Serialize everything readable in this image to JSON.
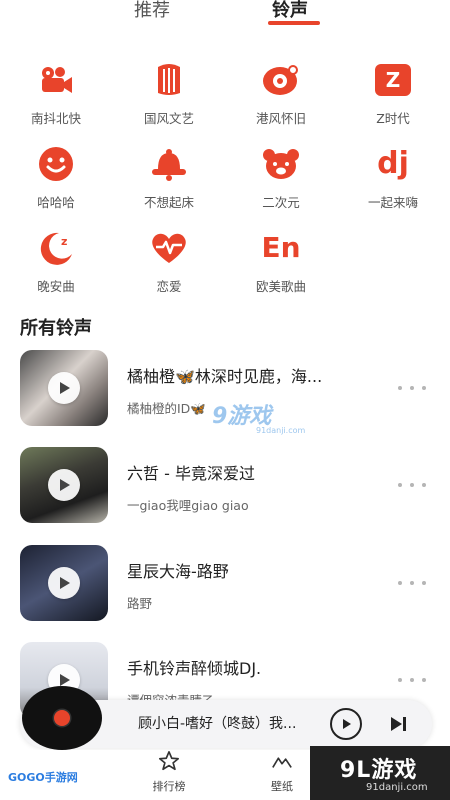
{
  "tabs": {
    "recommend": "推荐",
    "ringtone": "铃声"
  },
  "categories": [
    {
      "label": "南抖北快",
      "icon": "camera-icon"
    },
    {
      "label": "国风文艺",
      "icon": "harp-icon"
    },
    {
      "label": "港风怀旧",
      "icon": "vinyl-icon"
    },
    {
      "label": "Z时代",
      "icon": "z-icon",
      "glyph": "Z"
    },
    {
      "label": "哈哈哈",
      "icon": "smile-icon"
    },
    {
      "label": "不想起床",
      "icon": "bell-icon"
    },
    {
      "label": "二次元",
      "icon": "bear-icon"
    },
    {
      "label": "一起来嗨",
      "icon": "dj-icon",
      "glyph": "dj"
    },
    {
      "label": "晚安曲",
      "icon": "moon-icon"
    },
    {
      "label": "恋爱",
      "icon": "heartbeat-icon"
    },
    {
      "label": "欧美歌曲",
      "icon": "en-icon",
      "glyph": "En"
    }
  ],
  "section_title": "所有铃声",
  "songs": [
    {
      "title": "橘柚橙🦋林深时见鹿，海...",
      "artist": "橘柚橙的ID🦋"
    },
    {
      "title": "六哲 - 毕竟深爱过",
      "artist": "一giao我哩giao giao"
    },
    {
      "title": "星辰大海-路野",
      "artist": "路野"
    },
    {
      "title": "手机铃声醉倾城DJ.",
      "artist": "谭佣窕浓青䝼乙"
    }
  ],
  "watermark": {
    "text": "9游戏",
    "sub": "91danji.com"
  },
  "mini_player": {
    "title": "顾小白-嗜好（咚鼓）我..."
  },
  "bottom_nav": [
    {
      "label": "排行榜",
      "icon": "star-icon"
    },
    {
      "label": "壁纸",
      "icon": "mountain-icon"
    }
  ],
  "logos": {
    "left": "GOGO手游网",
    "right_big": "9L游戏",
    "right_small": "91danji.com"
  },
  "colors": {
    "accent": "#e8442b"
  }
}
